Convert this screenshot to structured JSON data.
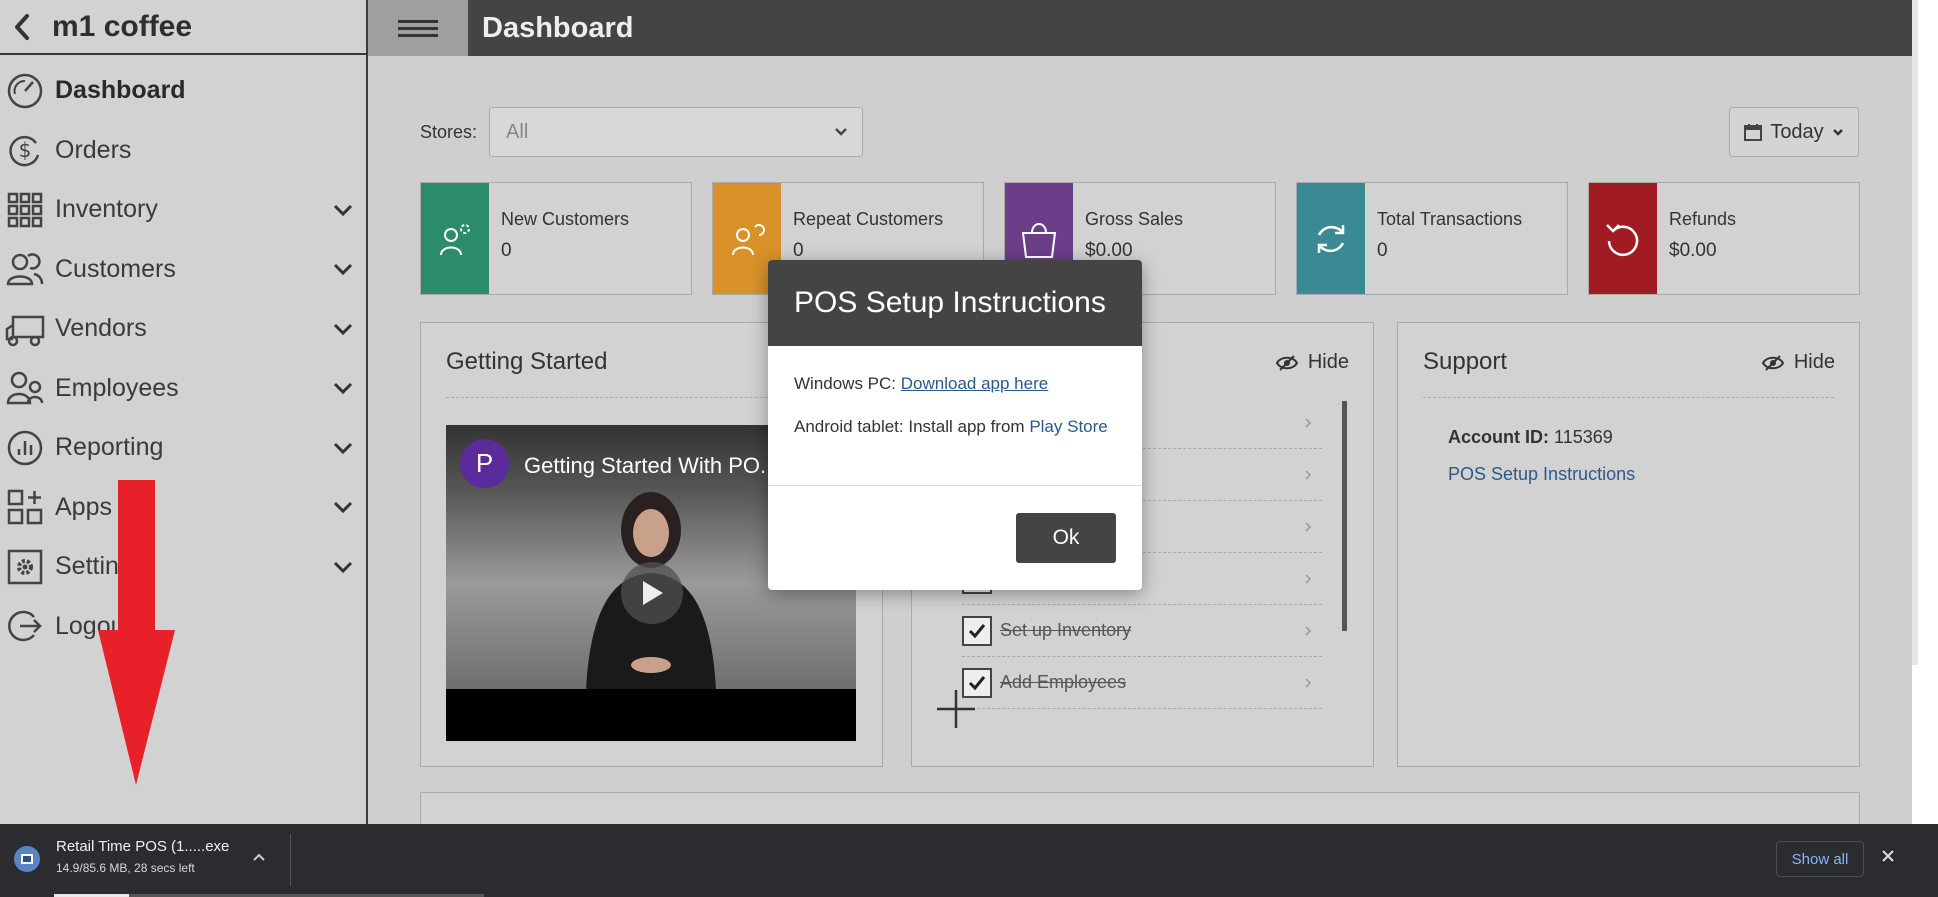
{
  "app": {
    "brand": "m1 coffee",
    "page_title": "Dashboard"
  },
  "sidebar": {
    "items": [
      {
        "label": "Dashboard",
        "icon": "dashboard-gauge-icon",
        "active": true,
        "expandable": false
      },
      {
        "label": "Orders",
        "icon": "dollar-cycle-icon",
        "expandable": false
      },
      {
        "label": "Inventory",
        "icon": "grid-icon",
        "expandable": true
      },
      {
        "label": "Customers",
        "icon": "users-icon",
        "expandable": true
      },
      {
        "label": "Vendors",
        "icon": "truck-icon",
        "expandable": true
      },
      {
        "label": "Employees",
        "icon": "employees-icon",
        "expandable": true
      },
      {
        "label": "Reporting",
        "icon": "bar-chart-circle-icon",
        "expandable": true
      },
      {
        "label": "Apps",
        "icon": "apps-grid-icon",
        "expandable": true
      },
      {
        "label": "Settings",
        "icon": "gear-icon",
        "expandable": true
      },
      {
        "label": "Logout",
        "icon": "logout-icon",
        "expandable": false
      }
    ]
  },
  "filters": {
    "stores_label": "Stores:",
    "stores_value": "All",
    "date_value": "Today"
  },
  "stat_cards": [
    {
      "title": "New Customers",
      "value": "0",
      "color": "#2a8c6a",
      "icon": "new-customer-icon"
    },
    {
      "title": "Repeat Customers",
      "value": "0",
      "color": "#d9912a",
      "icon": "repeat-customer-icon"
    },
    {
      "title": "Gross Sales",
      "value": "$0.00",
      "color": "#6b3e8a",
      "icon": "shopping-bag-icon"
    },
    {
      "title": "Total Transactions",
      "value": "0",
      "color": "#3a8a94",
      "icon": "refresh-icon"
    },
    {
      "title": "Refunds",
      "value": "$0.00",
      "color": "#a01c22",
      "icon": "refund-icon"
    }
  ],
  "getting_started": {
    "title": "Getting Started",
    "video": {
      "channel_initial": "P",
      "title": "Getting Started With PO..."
    }
  },
  "checklist_panel": {
    "hide_label": "Hide",
    "items": [
      {
        "label": "",
        "checked": false
      },
      {
        "label": "",
        "checked": false
      },
      {
        "label": "",
        "checked": false
      },
      {
        "label": "",
        "checked": true
      },
      {
        "label": "Set up Inventory",
        "checked": true
      },
      {
        "label": "Add Employees",
        "checked": true
      }
    ]
  },
  "support": {
    "title": "Support",
    "hide_label": "Hide",
    "account_label": "Account ID:",
    "account_id": "115369",
    "link": "POS Setup Instructions"
  },
  "modal": {
    "title": "POS Setup Instructions",
    "windows_prefix": "Windows PC:",
    "windows_link": "Download app here",
    "android_prefix": "Android tablet: Install app from",
    "android_link": "Play Store",
    "ok_label": "Ok"
  },
  "download_bar": {
    "file_name": "Retail Time POS (1.....exe",
    "status": "14.9/85.6 MB, 28 secs left",
    "progress": 0.174,
    "show_all": "Show all"
  }
}
